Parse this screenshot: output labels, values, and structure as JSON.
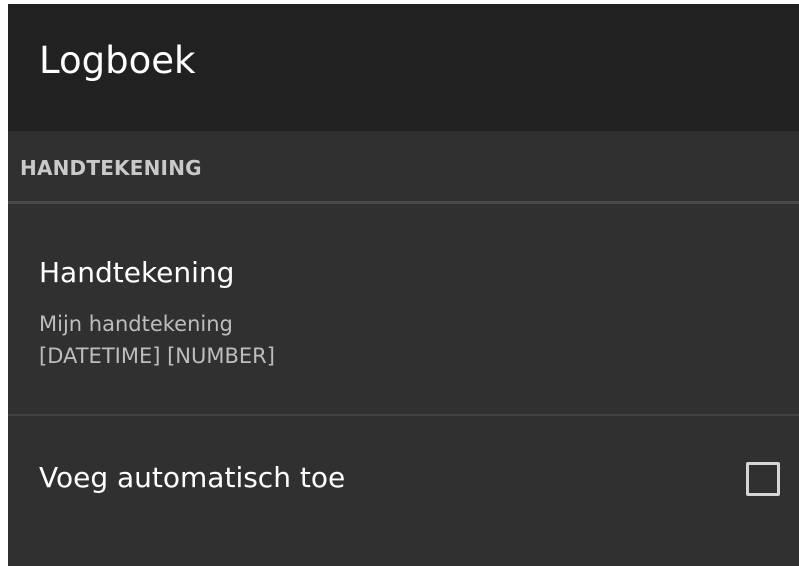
{
  "action_bar": {
    "title": "Logboek"
  },
  "category": {
    "title": "HANDTEKENING"
  },
  "preferences": {
    "signature": {
      "title": "Handtekening",
      "summary_line1": "Mijn handtekening",
      "summary_line2": "[DATETIME] [NUMBER]"
    },
    "auto_add": {
      "title": "Voeg automatisch toe",
      "checked": false
    }
  },
  "colors": {
    "action_bar_bg": "#212121",
    "screen_bg": "#303030",
    "category_text": "#c9c9c9",
    "divider": "#4a4a4a"
  }
}
